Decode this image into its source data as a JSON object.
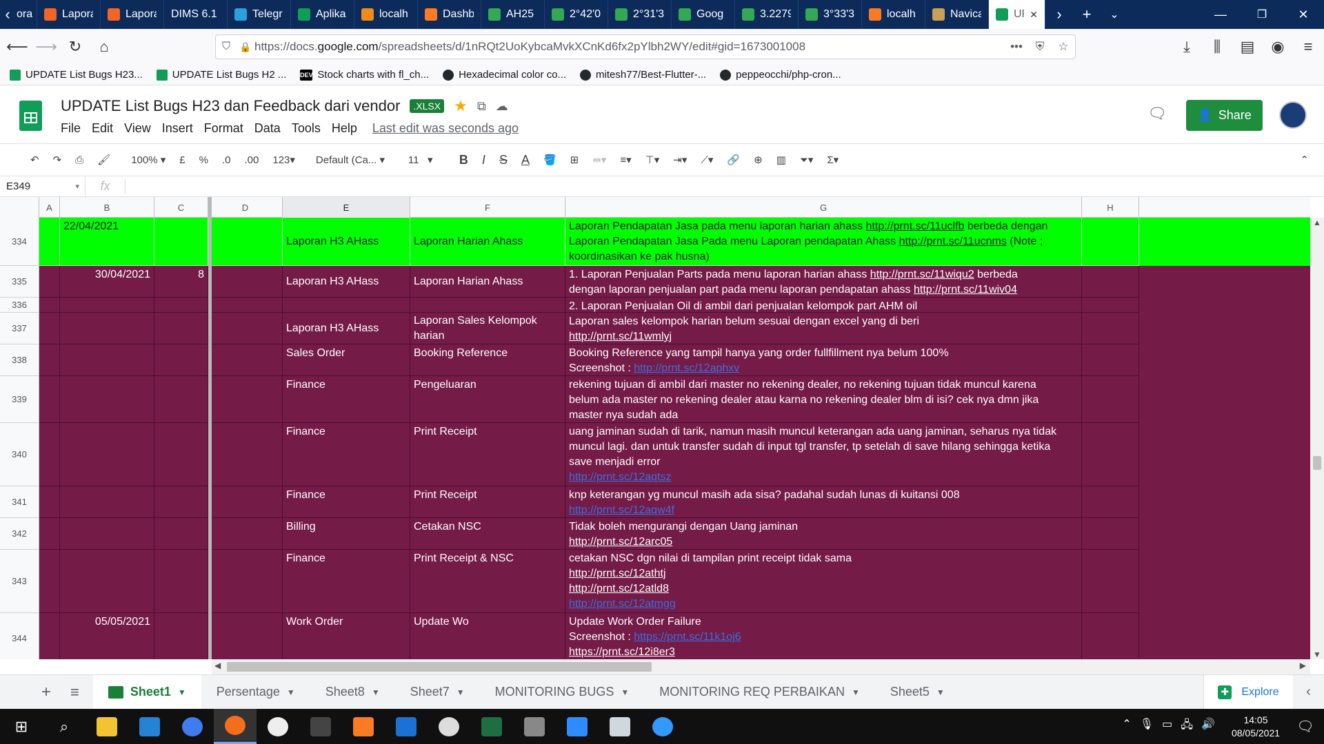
{
  "browser": {
    "tabs": [
      {
        "label": "Lapora",
        "icon": "cp-icon",
        "color": "#f26522"
      },
      {
        "label": "Lapora",
        "icon": "cp-icon",
        "color": "#f26522"
      },
      {
        "label": "DIMS 6.1",
        "icon": "",
        "color": ""
      },
      {
        "label": "Telegr",
        "icon": "telegram-icon",
        "color": "#2aa1da"
      },
      {
        "label": "Aplika",
        "icon": "sheets-icon",
        "color": "#0f9d58"
      },
      {
        "label": "localh",
        "icon": "xampp-icon",
        "color": "#f28b1b"
      },
      {
        "label": "Dashb",
        "icon": "xampp-icon",
        "color": "#fb7a24"
      },
      {
        "label": "AH25",
        "icon": "maps-pin-icon",
        "color": "#34a853"
      },
      {
        "label": "2°42'0",
        "icon": "maps-pin-icon",
        "color": "#34a853"
      },
      {
        "label": "2°31'3",
        "icon": "maps-pin-icon",
        "color": "#34a853"
      },
      {
        "label": "Goog",
        "icon": "maps-pin-icon",
        "color": "#34a853"
      },
      {
        "label": "3.2279",
        "icon": "maps-pin-icon",
        "color": "#34a853"
      },
      {
        "label": "3°33'3",
        "icon": "maps-pin-icon",
        "color": "#34a853"
      },
      {
        "label": "localh",
        "icon": "xampp-icon",
        "color": "#fb7a24"
      },
      {
        "label": "Navica",
        "icon": "navicat-icon",
        "color": "#caa055"
      },
      {
        "label": "UP",
        "icon": "sheets-icon",
        "color": "#0f9d58"
      }
    ],
    "first_tab_label": "ora",
    "url_prefix": "https://docs.",
    "url_domain": "google.com",
    "url_rest": "/spreadsheets/d/1nRQt2UoKybcaMvkXCnKd6fx2pYlbh2WY/edit#gid=1673001008",
    "bookmarks": [
      {
        "label": "UPDATE List Bugs H23...",
        "icon": "sheets-icon"
      },
      {
        "label": "UPDATE List Bugs H2 ...",
        "icon": "sheets-icon"
      },
      {
        "label": "Stock charts with fl_ch...",
        "icon": "dev-icon",
        "badge": "DEV"
      },
      {
        "label": "Hexadecimal color co...",
        "icon": "github-icon"
      },
      {
        "label": "mitesh77/Best-Flutter-...",
        "icon": "github-icon"
      },
      {
        "label": "peppeocchi/php-cron...",
        "icon": "github-icon"
      }
    ]
  },
  "doc": {
    "title": "UPDATE List Bugs H23 dan Feedback dari vendor",
    "badge": ".XLSX",
    "menus": [
      "File",
      "Edit",
      "View",
      "Insert",
      "Format",
      "Data",
      "Tools",
      "Help"
    ],
    "last_edit": "Last edit was seconds ago",
    "share_label": "Share"
  },
  "toolbar": {
    "zoom": "100%",
    "currency": "£",
    "percent": "%",
    "dec_less": ".0",
    "dec_more": ".00",
    "format_more": "123",
    "font": "Default (Ca...",
    "font_size": "11",
    "bold": "B",
    "italic": "I",
    "strike": "S",
    "text_color": "A"
  },
  "formula": {
    "cell_ref": "E349",
    "fx": "fx",
    "value": ""
  },
  "columns": [
    "A",
    "B",
    "C",
    "D",
    "E",
    "F",
    "G",
    "H"
  ],
  "rows": [
    {
      "num": "334",
      "date": "22/04/2021",
      "count": "",
      "module": "Laporan H3 AHass",
      "sub": "Laporan Harian Ahass",
      "lines": [
        {
          "parts": [
            {
              "t": "Laporan Pendapatan Jasa pada menu laporan harian ahass "
            },
            {
              "t": "http://prnt.sc/11uclfb",
              "link": "u"
            },
            {
              "t": " berbeda dengan"
            }
          ]
        },
        {
          "parts": [
            {
              "t": "Laporan Pendapatan Jasa Pada menu Laporan pendapatan Ahass "
            },
            {
              "t": "http://prnt.sc/11ucnms",
              "link": "u"
            },
            {
              "t": " (Note ;"
            }
          ]
        },
        {
          "parts": [
            {
              "t": "koordinasikan ke pak husna)"
            }
          ]
        }
      ]
    },
    {
      "num": "335",
      "date": "30/04/2021",
      "count": "8",
      "module": "Laporan H3 AHass",
      "sub": "Laporan Harian Ahass",
      "lines": [
        {
          "parts": [
            {
              "t": "1. Laporan Penjualan Parts pada menu laporan harian ahass "
            },
            {
              "t": "http://prnt.sc/11wiqu2",
              "link": "u"
            },
            {
              "t": " berbeda"
            }
          ]
        },
        {
          "parts": [
            {
              "t": "dengan laporan penjualan part pada menu laporan pendapatan ahass "
            },
            {
              "t": "http://prnt.sc/11wiv04",
              "link": "u"
            }
          ]
        }
      ]
    },
    {
      "num": "336",
      "lines": [
        {
          "parts": [
            {
              "t": "2. Laporan Penjualan Oil di ambil dari penjualan kelompok part AHM oil"
            }
          ]
        }
      ]
    },
    {
      "num": "337",
      "module": "Laporan H3 AHass",
      "sub": "Laporan Sales Kelompok harian",
      "lines": [
        {
          "parts": [
            {
              "t": "Laporan sales kelompok harian belum sesuai dengan excel yang di beri"
            }
          ]
        },
        {
          "parts": [
            {
              "t": "http://prnt.sc/11wmlyj",
              "link": "u"
            }
          ]
        }
      ]
    },
    {
      "num": "338",
      "module": "Sales Order",
      "sub": "Booking Reference",
      "lines": [
        {
          "parts": [
            {
              "t": "Booking Reference yang tampil hanya yang order fullfillment nya belum 100%"
            }
          ]
        },
        {
          "parts": [
            {
              "t": "Screenshot : "
            },
            {
              "t": "http://prnt.sc/12aphxv",
              "link": "b"
            }
          ]
        }
      ]
    },
    {
      "num": "339",
      "module": "Finance",
      "sub": "Pengeluaran",
      "lines": [
        {
          "parts": [
            {
              "t": "rekening tujuan di ambil dari master no rekening dealer, no rekening tujuan tidak muncul karena"
            }
          ]
        },
        {
          "parts": [
            {
              "t": "belum ada master no rekening dealer atau karna no rekening dealer blm di isi? cek nya dmn jika"
            }
          ]
        },
        {
          "parts": [
            {
              "t": "master nya sudah ada"
            }
          ]
        }
      ]
    },
    {
      "num": "340",
      "module": "Finance",
      "sub": "Print Receipt",
      "lines": [
        {
          "parts": [
            {
              "t": "uang jaminan sudah di tarik, namun masih muncul keterangan ada uang jaminan, seharus nya tidak"
            }
          ]
        },
        {
          "parts": [
            {
              "t": "muncul lagi. dan untuk transfer sudah di input tgl transfer, tp setelah di save hilang sehingga ketika"
            }
          ]
        },
        {
          "parts": [
            {
              "t": "save menjadi error"
            }
          ]
        },
        {
          "parts": [
            {
              "t": "http://prnt.sc/12aqtsz",
              "link": "b"
            }
          ]
        }
      ]
    },
    {
      "num": "341",
      "module": "Finance",
      "sub": "Print Receipt",
      "lines": [
        {
          "parts": [
            {
              "t": "knp keterangan yg muncul masih ada sisa? padahal sudah lunas di kuitansi 008"
            }
          ]
        },
        {
          "parts": [
            {
              "t": "http://prnt.sc/12aqw4f",
              "link": "b"
            }
          ]
        }
      ]
    },
    {
      "num": "342",
      "module": "Billing",
      "sub": "Cetakan NSC",
      "lines": [
        {
          "parts": [
            {
              "t": "Tidak boleh mengurangi dengan Uang jaminan"
            }
          ]
        },
        {
          "parts": [
            {
              "t": "http://prnt.sc/12arc05",
              "link": "u"
            }
          ]
        }
      ]
    },
    {
      "num": "343",
      "module": "Finance",
      "sub": "Print Receipt & NSC",
      "lines": [
        {
          "parts": [
            {
              "t": "cetakan NSC dgn nilai di tampilan print receipt tidak sama"
            }
          ]
        },
        {
          "parts": [
            {
              "t": "http://prnt.sc/12athtj",
              "link": "u"
            }
          ]
        },
        {
          "parts": [
            {
              "t": "http://prnt.sc/12atld8",
              "link": "u"
            }
          ]
        },
        {
          "parts": [
            {
              "t": "http://prnt.sc/12atmgg",
              "link": "b"
            }
          ]
        }
      ]
    },
    {
      "num": "344",
      "date": "05/05/2021",
      "module": "Work Order",
      "sub": "Update Wo",
      "lines": [
        {
          "parts": [
            {
              "t": "Update Work Order Failure"
            }
          ]
        },
        {
          "parts": [
            {
              "t": "Screenshot : "
            },
            {
              "t": "https://prnt.sc/11k1oj6",
              "link": "b"
            }
          ]
        },
        {
          "parts": [
            {
              "t": "https://prnt.sc/12i8er3",
              "link": "u"
            }
          ]
        }
      ]
    }
  ],
  "sheets": [
    {
      "label": "Sheet1",
      "active": true
    },
    {
      "label": "Persentage"
    },
    {
      "label": "Sheet8"
    },
    {
      "label": "Sheet7"
    },
    {
      "label": "MONITORING BUGS"
    },
    {
      "label": "MONITORING REQ PERBAIKAN"
    },
    {
      "label": "Sheet5"
    }
  ],
  "explore_label": "Explore",
  "clock": {
    "time": "14:05",
    "date": "08/05/2021"
  },
  "colors": {
    "row_green": "#00ff00",
    "row_maroon": "#741b47",
    "share_green": "#1e8e3e"
  }
}
